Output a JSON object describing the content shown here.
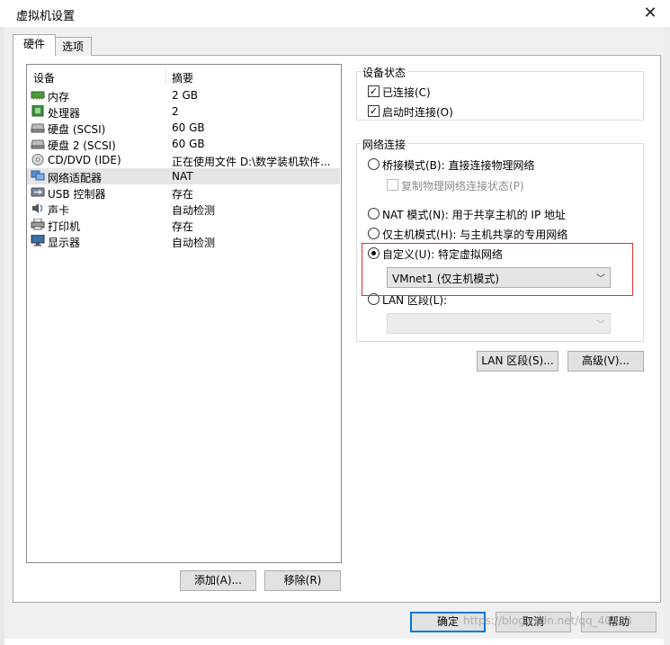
{
  "window": {
    "title": "虚拟机设置",
    "close": "✕"
  },
  "tabs": [
    {
      "label": "硬件"
    },
    {
      "label": "选项"
    }
  ],
  "devices": {
    "headers": {
      "device": "设备",
      "summary": "摘要"
    },
    "rows": [
      {
        "name": "内存",
        "summary": "2 GB",
        "icon": "memory-icon"
      },
      {
        "name": "处理器",
        "summary": "2",
        "icon": "processor-icon"
      },
      {
        "name": "硬盘 (SCSI)",
        "summary": "60 GB",
        "icon": "harddisk-icon"
      },
      {
        "name": "硬盘 2 (SCSI)",
        "summary": "60 GB",
        "icon": "harddisk-icon"
      },
      {
        "name": "CD/DVD (IDE)",
        "summary": "正在使用文件 D:\\数学装机软件...",
        "icon": "cd-dvd-icon"
      },
      {
        "name": "网络适配器",
        "summary": "NAT",
        "icon": "network-adapter-icon",
        "selected": true
      },
      {
        "name": "USB 控制器",
        "summary": "存在",
        "icon": "usb-icon"
      },
      {
        "name": "声卡",
        "summary": "自动检测",
        "icon": "sound-card-icon"
      },
      {
        "name": "打印机",
        "summary": "存在",
        "icon": "printer-icon"
      },
      {
        "name": "显示器",
        "summary": "自动检测",
        "icon": "display-icon"
      }
    ],
    "add_button": "添加(A)...",
    "remove_button": "移除(R)"
  },
  "device_status": {
    "title": "设备状态",
    "connected": {
      "label": "已连接(C)",
      "checked": true
    },
    "connect_at_power_on": {
      "label": "启动时连接(O)",
      "checked": true
    }
  },
  "network": {
    "title": "网络连接",
    "bridged": {
      "label": "桥接模式(B): 直接连接物理网络",
      "selected": false
    },
    "replicate": {
      "label": "复制物理网络连接状态(P)",
      "checked": false,
      "disabled": true
    },
    "nat": {
      "label": "NAT 模式(N): 用于共享主机的 IP 地址",
      "selected": false
    },
    "host_only": {
      "label": "仅主机模式(H): 与主机共享的专用网络",
      "selected": false
    },
    "custom": {
      "label": "自定义(U): 特定虚拟网络",
      "selected": true
    },
    "custom_select": {
      "value": "VMnet1 (仅主机模式)"
    },
    "lan_segment": {
      "label": "LAN 区段(L):",
      "selected": false
    },
    "lan_select": {
      "value": ""
    },
    "lan_segments_button": "LAN 区段(S)...",
    "advanced_button": "高级(V)..."
  },
  "footer": {
    "ok": "确定",
    "cancel": "取消",
    "help": "帮助"
  },
  "watermark": "https://blog.csdn.net/qq_40933"
}
